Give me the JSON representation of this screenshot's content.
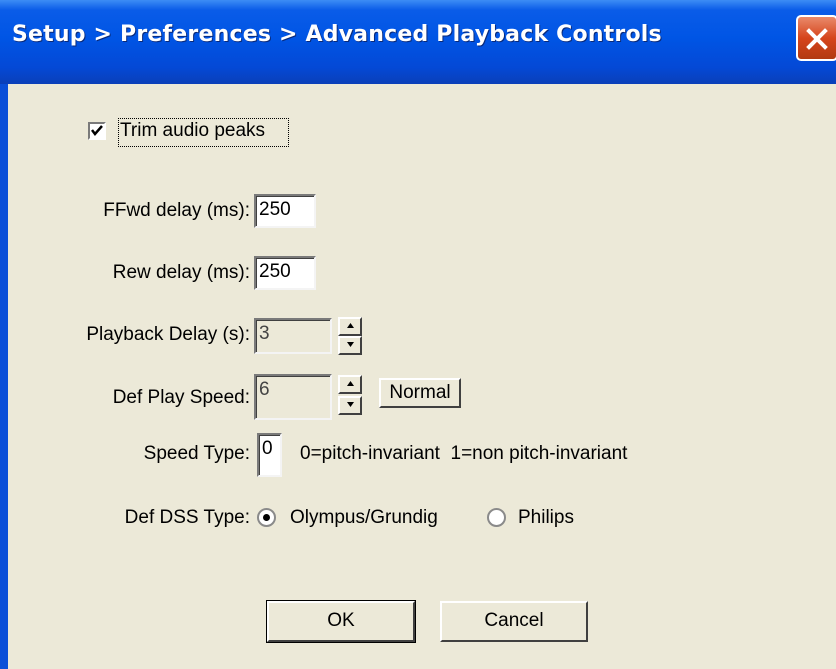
{
  "window": {
    "title": "Setup > Preferences > Advanced Playback Controls"
  },
  "trim_audio_peaks": {
    "label": "Trim audio peaks",
    "checked": true
  },
  "ffwd_delay": {
    "label": "FFwd delay (ms):",
    "value": "250"
  },
  "rew_delay": {
    "label": "Rew delay (ms):",
    "value": "250"
  },
  "playback_delay": {
    "label": "Playback Delay (s):",
    "value": "3"
  },
  "def_play_speed": {
    "label": "Def Play Speed:",
    "value": "6",
    "normal_button": "Normal"
  },
  "speed_type": {
    "label": "Speed Type:",
    "value": "0",
    "hint": "0=pitch-invariant  1=non pitch-invariant"
  },
  "def_dss_type": {
    "label": "Def DSS Type:",
    "selected": "Olympus/Grundig",
    "options": [
      "Olympus/Grundig",
      "Philips"
    ]
  },
  "buttons": {
    "ok": "OK",
    "cancel": "Cancel"
  },
  "colors": {
    "title_bar": "#0055e5",
    "close_button": "#d6451c",
    "dialog_bg": "#ece9d8"
  }
}
